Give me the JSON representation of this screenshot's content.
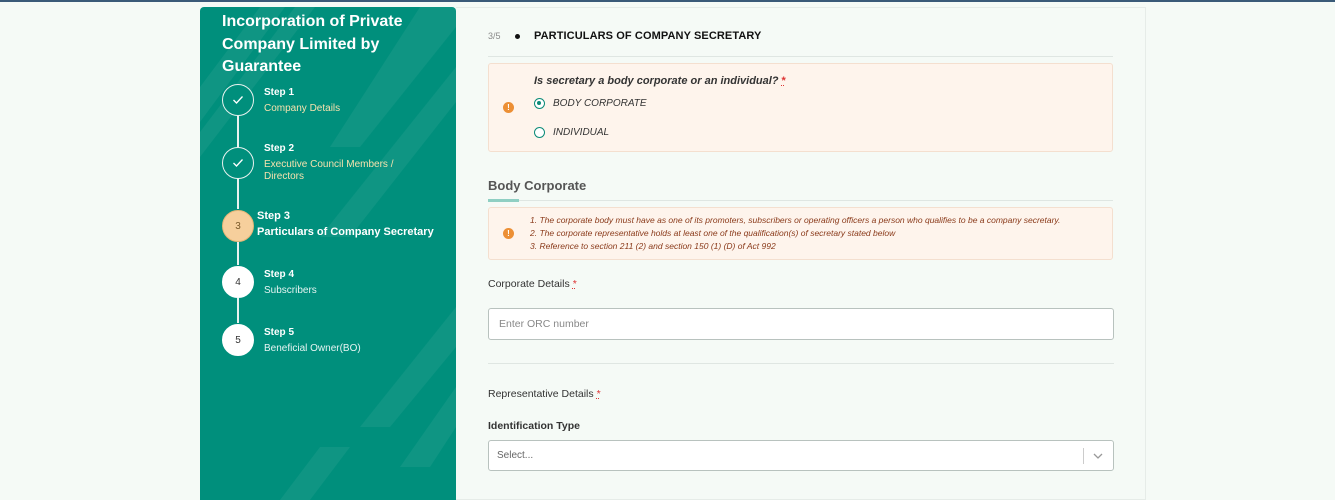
{
  "sidebar": {
    "title": "Incorporation of Private Company Limited by Guarantee",
    "steps": [
      {
        "number": "Step 1",
        "name": "Company Details",
        "status": "done",
        "marker": "✓"
      },
      {
        "number": "Step 2",
        "name": "Executive Council Members / Directors",
        "status": "done",
        "marker": "✓"
      },
      {
        "number": "Step 3",
        "name": "Particulars of Company Secretary",
        "status": "active",
        "marker": "3"
      },
      {
        "number": "Step 4",
        "name": "Subscribers",
        "status": "pending",
        "marker": "4"
      },
      {
        "number": "Step 5",
        "name": "Beneficial Owner(BO)",
        "status": "pending",
        "marker": "5"
      }
    ]
  },
  "main": {
    "step_counter": "3/5",
    "section_title": "PARTICULARS OF COMPANY SECRETARY",
    "secretary_question": {
      "label": "Is secretary a body corporate or an individual?",
      "required_mark": "*",
      "options": [
        {
          "label": "BODY CORPORATE",
          "selected": true
        },
        {
          "label": "INDIVIDUAL",
          "selected": false
        }
      ]
    },
    "body_corporate": {
      "heading": "Body Corporate",
      "notes": [
        "1. The corporate body must have as one of its promoters, subscribers or operating officers a person who qualifies to be a company secretary.",
        "2. The corporate representative holds at least one of the qualification(s) of secretary stated below",
        "3. Reference to section 211 (2) and section 150 (1) (D) of Act 992"
      ]
    },
    "corporate_details": {
      "label": "Corporate Details",
      "required_mark": "*",
      "placeholder": "Enter ORC number",
      "value": ""
    },
    "representative_details": {
      "label": "Representative Details",
      "required_mark": "*",
      "identification_type": {
        "label": "Identification Type",
        "placeholder": "Select..."
      }
    },
    "warning_icon_glyph": "!"
  },
  "colors": {
    "sidebar_bg": "#008f7c",
    "active_step": "#f6cf9c",
    "warning_bg": "#fef4ec",
    "warning_icon": "#ec8f35",
    "accent": "#0b8b78"
  }
}
